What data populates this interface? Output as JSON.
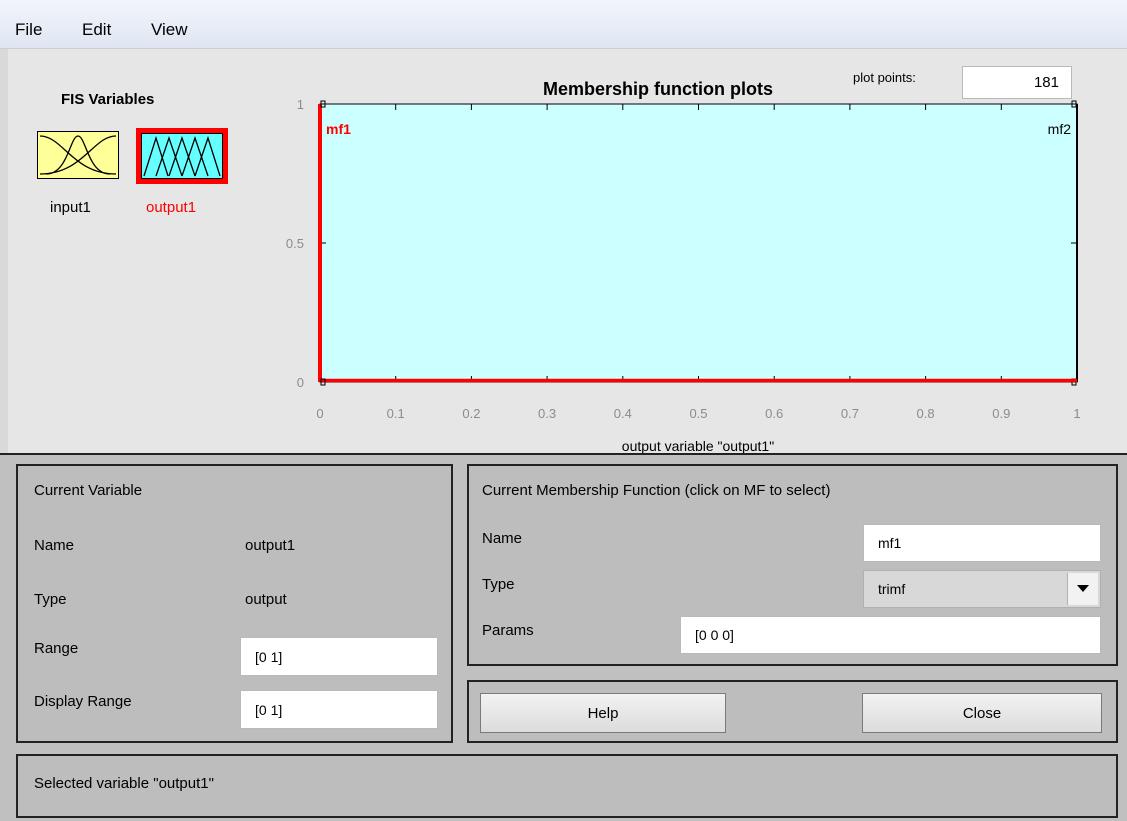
{
  "menu": {
    "items": [
      "File",
      "Edit",
      "View"
    ]
  },
  "fis_variables": {
    "title": "FIS Variables",
    "input_label": "input1",
    "output_label": "output1"
  },
  "plot": {
    "title": "Membership function plots",
    "plot_points_label": "plot points:",
    "plot_points_value": "181",
    "xlabel": "output variable \"output1\"",
    "x_ticks": [
      "0",
      "0.1",
      "0.2",
      "0.3",
      "0.4",
      "0.5",
      "0.6",
      "0.7",
      "0.8",
      "0.9",
      "1"
    ],
    "y_ticks": [
      "0",
      "0.5",
      "1"
    ],
    "mf_labels": [
      "mf1",
      "mf2"
    ],
    "background_color": "#ccffff",
    "selected_color": "#ff0000",
    "unselected_color": "#000000"
  },
  "chart_data": {
    "type": "line",
    "xlabel": "output variable \"output1\"",
    "ylabel": "",
    "xlim": [
      0,
      1
    ],
    "ylim": [
      0,
      1
    ],
    "series": [
      {
        "name": "mf1",
        "x": [
          0,
          0,
          0
        ],
        "y": [
          0,
          1,
          0
        ],
        "selected": true
      },
      {
        "name": "mf2",
        "x": [
          1,
          1,
          1
        ],
        "y": [
          0,
          1,
          0
        ],
        "selected": false
      }
    ]
  },
  "current_variable": {
    "header": "Current Variable",
    "name_label": "Name",
    "name_value": "output1",
    "type_label": "Type",
    "type_value": "output",
    "range_label": "Range",
    "range_value": "[0 1]",
    "display_range_label": "Display Range",
    "display_range_value": "[0 1]"
  },
  "current_mf": {
    "header": "Current Membership Function (click on MF to select)",
    "name_label": "Name",
    "name_value": "mf1",
    "type_label": "Type",
    "type_value": "trimf",
    "params_label": "Params",
    "params_value": "[0 0 0]"
  },
  "buttons": {
    "help": "Help",
    "close": "Close"
  },
  "status": {
    "text": "Selected variable \"output1\""
  }
}
